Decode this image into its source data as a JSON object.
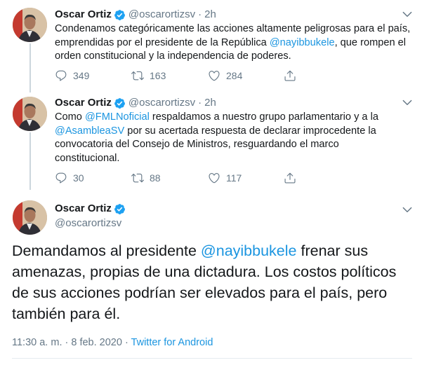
{
  "tweets": [
    {
      "name": "Oscar Ortiz",
      "handle": "@oscarortizsv",
      "dot": "·",
      "time": "2h",
      "text_parts": [
        "Condenamos categóricamente las acciones altamente peligrosas para el país, emprendidas por el presidente de la República ",
        "@nayibbukele",
        ", que rompen el orden constitucional y la independencia de poderes."
      ],
      "replies": "349",
      "retweets": "163",
      "likes": "284"
    },
    {
      "name": "Oscar Ortiz",
      "handle": "@oscarortizsv",
      "dot": "·",
      "time": "2h",
      "text_parts": [
        "Como ",
        "@FMLNoficial",
        " respaldamos a nuestro grupo parlamentario y a la ",
        "@AsambleaSV",
        " por su acertada respuesta de declarar improcedente la convocatoria del Consejo de Ministros, resguardando el marco constitucional."
      ],
      "replies": "30",
      "retweets": "88",
      "likes": "117"
    }
  ],
  "main_tweet": {
    "name": "Oscar Ortiz",
    "handle": "@oscarortizsv",
    "text_parts": [
      "Demandamos al presidente ",
      "@nayibbukele",
      " frenar sus amenazas, propias de una dictadura. Los costos políticos de sus acciones podrían ser elevados para el país, pero también para él."
    ],
    "timestamp": "11:30 a. m. · 8 feb. 2020 · ",
    "source": "Twitter for Android"
  },
  "colors": {
    "link": "#1b95e0",
    "verified": "#1da1f2",
    "secondary_text": "#657786",
    "primary_text": "#14171a"
  },
  "icons": [
    "verified-icon",
    "chevron-down-icon",
    "reply-icon",
    "retweet-icon",
    "like-icon",
    "share-icon"
  ]
}
